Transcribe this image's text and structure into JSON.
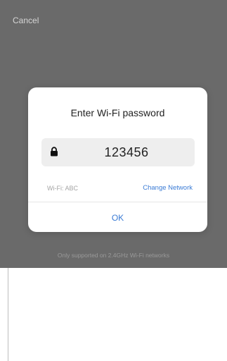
{
  "top_bar": {
    "cancel_label": "Cancel"
  },
  "dialog": {
    "title": "Enter Wi-Fi password",
    "password_value": "123456",
    "wifi_label": "Wi-Fi: ABC",
    "change_network_label": "Change Network",
    "ok_label": "OK"
  },
  "footer": {
    "note": "Only supported on 2.4GHz Wi-Fi networks"
  },
  "colors": {
    "overlay": "#6a6a6a",
    "accent": "#3a7bd5"
  },
  "icons": {
    "password_icon": "lock-icon"
  }
}
